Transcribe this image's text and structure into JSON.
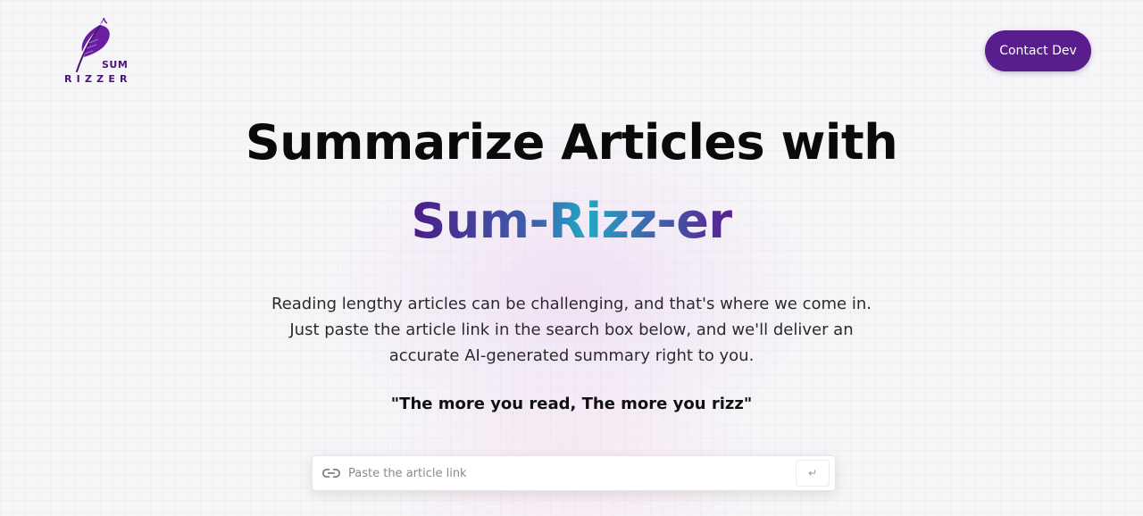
{
  "logo": {
    "icon": "feather-quill-icon",
    "line1": "SUM",
    "line2": "RIZZER",
    "color": "#4a1478"
  },
  "header": {
    "contact_label": "Contact Dev",
    "contact_color": "#5a1d8e"
  },
  "hero": {
    "title_line1": "Summarize Articles with",
    "title_brand": "Sum-Rizz-er",
    "description": [
      "Reading lengthy articles can be challenging, and that's where we come in.",
      "Just paste the article link in the search box below, and we'll deliver an",
      "accurate AI-generated summary right to you."
    ],
    "quote": "\"The more you read, The more you rizz\""
  },
  "search": {
    "icon": "link-icon",
    "placeholder": "Paste the article link",
    "value": "",
    "submit_icon": "enter-return-icon",
    "submit_glyph": "↵"
  }
}
